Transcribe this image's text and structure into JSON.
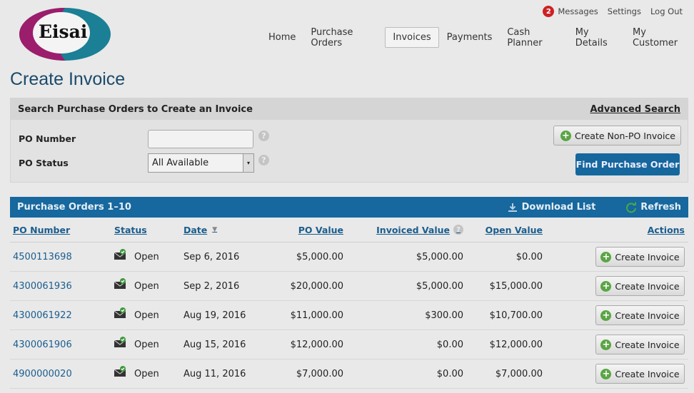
{
  "brand": {
    "logo_text": "Eisai",
    "colors": {
      "magenta": "#9c1d6b",
      "teal": "#1b7f95",
      "primary_blue": "#16689e",
      "badge_red": "#cc2222"
    }
  },
  "utility": {
    "messages_count": "2",
    "messages_label": "Messages",
    "settings_label": "Settings",
    "logout_label": "Log Out"
  },
  "nav": {
    "items": [
      {
        "label": "Home"
      },
      {
        "label": "Purchase Orders"
      },
      {
        "label": "Invoices",
        "active": true
      },
      {
        "label": "Payments"
      },
      {
        "label": "Cash Planner"
      },
      {
        "label": "My Details"
      },
      {
        "label": "My Customer"
      }
    ]
  },
  "page_title": "Create Invoice",
  "search": {
    "heading": "Search Purchase Orders to Create an Invoice",
    "advanced_link": "Advanced Search",
    "po_number_label": "PO Number",
    "po_number_value": "",
    "po_status_label": "PO Status",
    "po_status_selected": "All Available",
    "help_glyph": "?",
    "non_po_button": "Create Non-PO Invoice",
    "find_button": "Find Purchase Order"
  },
  "results": {
    "count_label": "Purchase Orders 1–10",
    "download_label": "Download List",
    "refresh_label": "Refresh",
    "columns": {
      "po_number": "PO Number",
      "status": "Status",
      "date": "Date",
      "po_value": "PO Value",
      "invoiced_value": "Invoiced Value",
      "open_value": "Open Value",
      "actions": "Actions"
    },
    "rows": [
      {
        "po_number": "4500113698",
        "status": "Open",
        "date": "Sep 6, 2016",
        "po_value": "$5,000.00",
        "invoiced_value": "$5,000.00",
        "open_value": "$0.00",
        "action": "Create Invoice"
      },
      {
        "po_number": "4300061936",
        "status": "Open",
        "date": "Sep 2, 2016",
        "po_value": "$20,000.00",
        "invoiced_value": "$5,000.00",
        "open_value": "$15,000.00",
        "action": "Create Invoice"
      },
      {
        "po_number": "4300061922",
        "status": "Open",
        "date": "Aug 19, 2016",
        "po_value": "$11,000.00",
        "invoiced_value": "$300.00",
        "open_value": "$10,700.00",
        "action": "Create Invoice"
      },
      {
        "po_number": "4300061906",
        "status": "Open",
        "date": "Aug 15, 2016",
        "po_value": "$12,000.00",
        "invoiced_value": "$0.00",
        "open_value": "$12,000.00",
        "action": "Create Invoice"
      },
      {
        "po_number": "4900000020",
        "status": "Open",
        "date": "Aug 11, 2016",
        "po_value": "$7,000.00",
        "invoiced_value": "$0.00",
        "open_value": "$7,000.00",
        "action": "Create Invoice"
      }
    ]
  }
}
